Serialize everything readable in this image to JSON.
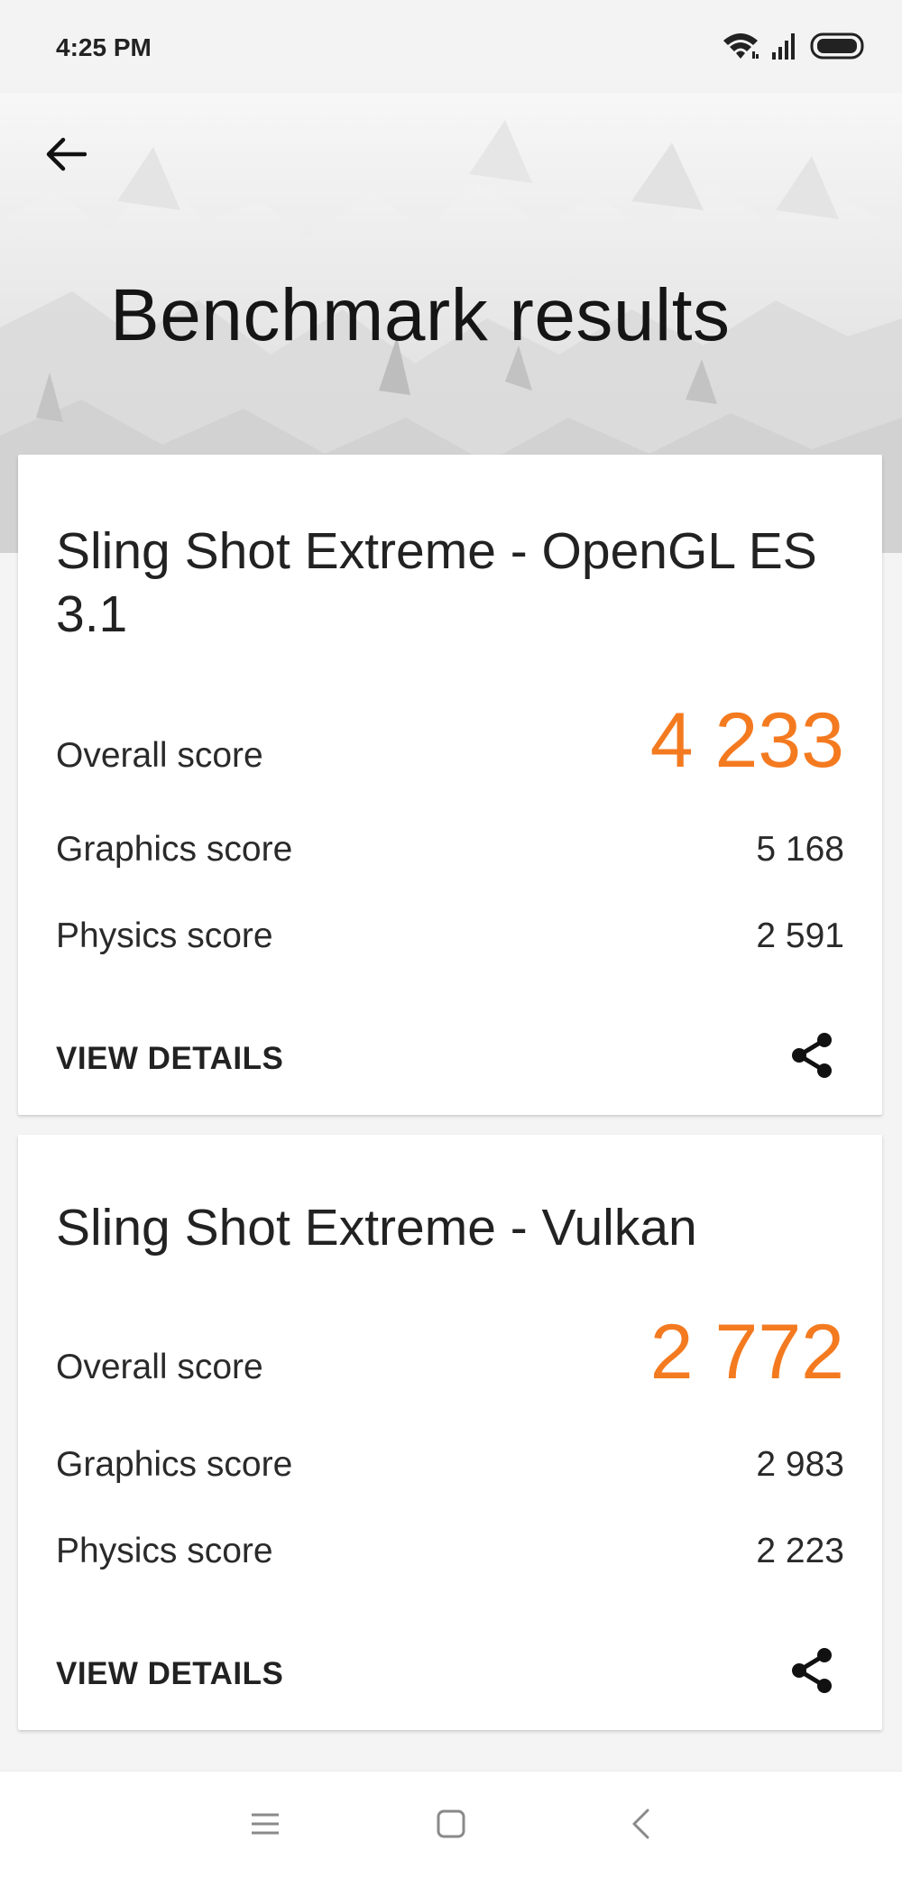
{
  "status_bar": {
    "time": "4:25 PM",
    "icons": [
      "wifi-icon",
      "signal-icon",
      "battery-icon"
    ]
  },
  "header": {
    "back_icon": "arrow-left-icon",
    "title": "Benchmark results"
  },
  "results": [
    {
      "test_name": "Sling Shot Extreme - OpenGL ES 3.1",
      "overall_label": "Overall score",
      "overall_value": "4 233",
      "graphics_label": "Graphics score",
      "graphics_value": "5 168",
      "physics_label": "Physics score",
      "physics_value": "2 591",
      "details_label": "VIEW DETAILS",
      "share_icon": "share-icon"
    },
    {
      "test_name": "Sling Shot Extreme - Vulkan",
      "overall_label": "Overall score",
      "overall_value": "2 772",
      "graphics_label": "Graphics score",
      "graphics_value": "2 983",
      "physics_label": "Physics score",
      "physics_value": "2 223",
      "details_label": "VIEW DETAILS",
      "share_icon": "share-icon"
    }
  ],
  "nav_bar": {
    "icons": [
      "menu-icon",
      "home-icon",
      "back-icon"
    ]
  },
  "colors": {
    "accent": "#f47a20",
    "text": "#222222",
    "card_background": "#ffffff",
    "page_background": "#f4f4f4"
  }
}
